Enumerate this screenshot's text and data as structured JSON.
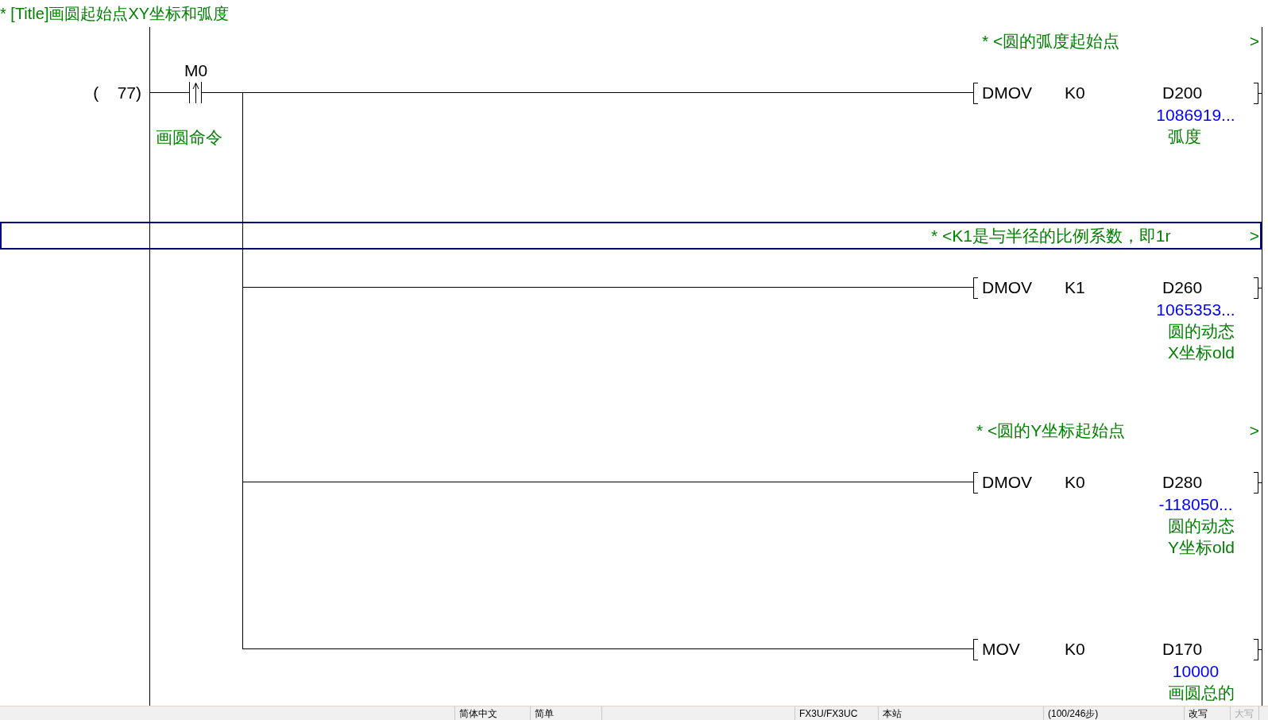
{
  "title_comment": "* [Title]画圆起始点XY坐标和弧度",
  "rung": {
    "step": "(    77)",
    "contact": {
      "kind": "rising_edge",
      "device": "M0",
      "comment": "画圆命令"
    },
    "branches": [
      {
        "statement": {
          "text": "* <圆的弧度起始点",
          "end_mark": ">",
          "selected": false
        },
        "instruction": {
          "op": "DMOV",
          "source": "K0",
          "destination": "D200",
          "current_value": "1086919...",
          "comment_lines": [
            "弧度"
          ]
        }
      },
      {
        "statement": {
          "text": "* <K1是与半径的比例系数，即1r",
          "end_mark": ">",
          "selected": true
        },
        "instruction": {
          "op": "DMOV",
          "source": "K1",
          "destination": "D260",
          "current_value": "1065353...",
          "comment_lines": [
            "圆的动态",
            "X坐标old"
          ]
        }
      },
      {
        "statement": {
          "text": "* <圆的Y坐标起始点",
          "end_mark": ">",
          "selected": false
        },
        "instruction": {
          "op": "DMOV",
          "source": "K0",
          "destination": "D280",
          "current_value": "-118050...",
          "comment_lines": [
            "圆的动态",
            "Y坐标old"
          ]
        }
      },
      {
        "instruction": {
          "op": "MOV",
          "source": "K0",
          "destination": "D170",
          "current_value": "10000",
          "comment_lines": [
            "画圆总的"
          ]
        }
      }
    ]
  },
  "status_bar": [
    {
      "text": "简体中文",
      "enabled": true
    },
    {
      "text": "简单",
      "enabled": true
    },
    {
      "text": "FX3U/FX3UC",
      "enabled": true
    },
    {
      "text": "本站",
      "enabled": true
    },
    {
      "text": "(100/246步)",
      "enabled": true
    },
    {
      "text": "改写",
      "enabled": true
    },
    {
      "text": "大写",
      "enabled": false
    }
  ]
}
